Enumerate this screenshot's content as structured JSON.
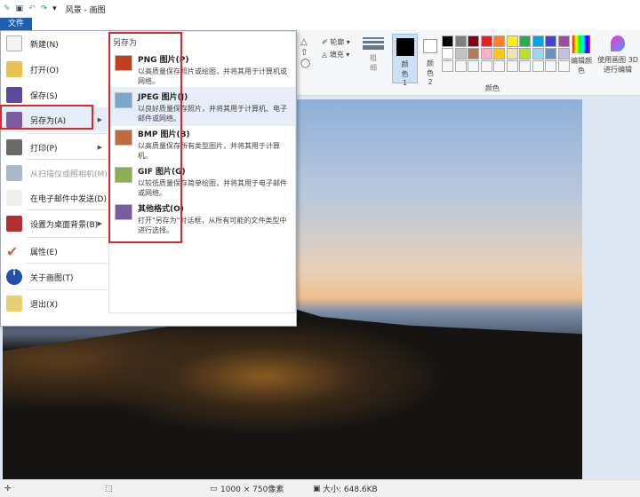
{
  "title": "风景 - 画图",
  "file_tab": "文件",
  "menu": {
    "items": [
      {
        "label": "新建(N)",
        "icon": "new-file-icon"
      },
      {
        "label": "打开(O)",
        "icon": "open-folder-icon"
      },
      {
        "label": "保存(S)",
        "icon": "save-icon"
      },
      {
        "label": "另存为(A)",
        "icon": "save-as-icon",
        "submenu": true
      },
      {
        "label": "打印(P)",
        "icon": "printer-icon",
        "submenu": true
      },
      {
        "label": "从扫描仪或照相机(M)",
        "icon": "scanner-icon",
        "disabled": true
      },
      {
        "label": "在电子邮件中发送(D)",
        "icon": "email-icon"
      },
      {
        "label": "设置为桌面背景(B)",
        "icon": "desktop-background-icon",
        "submenu": true
      },
      {
        "label": "属性(E)",
        "icon": "checkmark-icon"
      },
      {
        "label": "关于画图(T)",
        "icon": "info-icon"
      },
      {
        "label": "退出(X)",
        "icon": "exit-icon"
      }
    ],
    "save_as": {
      "header": "另存为",
      "options": [
        {
          "title": "PNG 图片(P)",
          "desc": "以高质量保存照片或绘图，并将其用于计算机或网络。"
        },
        {
          "title": "JPEG 图片(J)",
          "desc": "以良好质量保存照片，并将其用于计算机、电子邮件或网络。"
        },
        {
          "title": "BMP 图片(B)",
          "desc": "以高质量保存所有类型图片，并将其用于计算机。"
        },
        {
          "title": "GIF 图片(G)",
          "desc": "以较低质量保存简单绘图，并将其用于电子邮件或网络。"
        },
        {
          "title": "其他格式(O)",
          "desc": "打开\"另存为\"对话框，从所有可能的文件类型中进行选择。"
        }
      ]
    }
  },
  "ribbon": {
    "outline": "轮廓",
    "fill": "填充",
    "size": "粗细",
    "color1": "颜色 1",
    "color2": "颜色 2",
    "edit_colors": "编辑颜色",
    "paint3d": "使用画图 3D 进行编辑",
    "colors_group": "颜色",
    "palette": [
      "#000000",
      "#7f7f7f",
      "#880015",
      "#ed1c24",
      "#ff7f27",
      "#fff200",
      "#22b14c",
      "#00a2e8",
      "#3f48cc",
      "#a349a4",
      "#ffffff",
      "#c3c3c3",
      "#b97a57",
      "#ffaec9",
      "#ffc90e",
      "#efe4b0",
      "#b5e61d",
      "#99d9ea",
      "#7092be",
      "#c8bfe7"
    ]
  },
  "status": {
    "dimensions": "1000 × 750像素",
    "size": "大小: 648.6KB"
  }
}
